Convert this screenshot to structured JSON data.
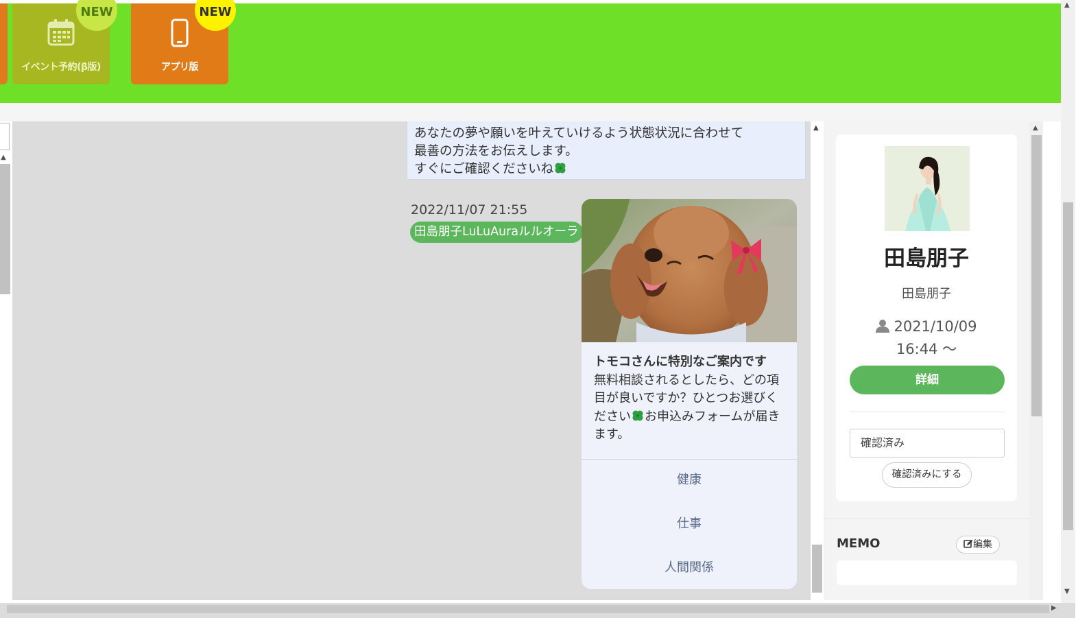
{
  "header": {
    "tiles": [
      {
        "label": "イベント予約(β版)",
        "badge": "NEW",
        "icon": "calendar-icon",
        "color": "#a7b722"
      },
      {
        "label": "アプリ版",
        "badge": "NEW",
        "icon": "smartphone-icon",
        "color": "#e07b17"
      }
    ],
    "bg_color": "#6ee027"
  },
  "chat": {
    "prev_message_lines": [
      "あなたの夢や願いを叶えていけるよう状態状況に合わせて",
      "最善の方法をお伝えします。",
      "すぐにご確認くださいね"
    ],
    "message": {
      "timestamp": "2022/11/07 21:55",
      "sender": "田島朋子LuLuAuraルルオーラ",
      "card": {
        "title": "トモコさんに特別なご案内です",
        "body_before_icon": "無料相談されるとしたら、どの項目が良いですか？ひとつお選びください",
        "body_after_icon": "お申込みフォームが届きます。",
        "options": [
          "健康",
          "仕事",
          "人間関係"
        ]
      }
    }
  },
  "profile": {
    "name": "田島朋子",
    "sub_name": "田島朋子",
    "date": "2021/10/09",
    "time": "16:44 〜",
    "detail_label": "詳細",
    "status_value": "確認済み",
    "confirm_label": "確認済みにする",
    "accent_color": "#5cb65c"
  },
  "memo": {
    "title": "MEMO",
    "edit_label": "編集"
  }
}
